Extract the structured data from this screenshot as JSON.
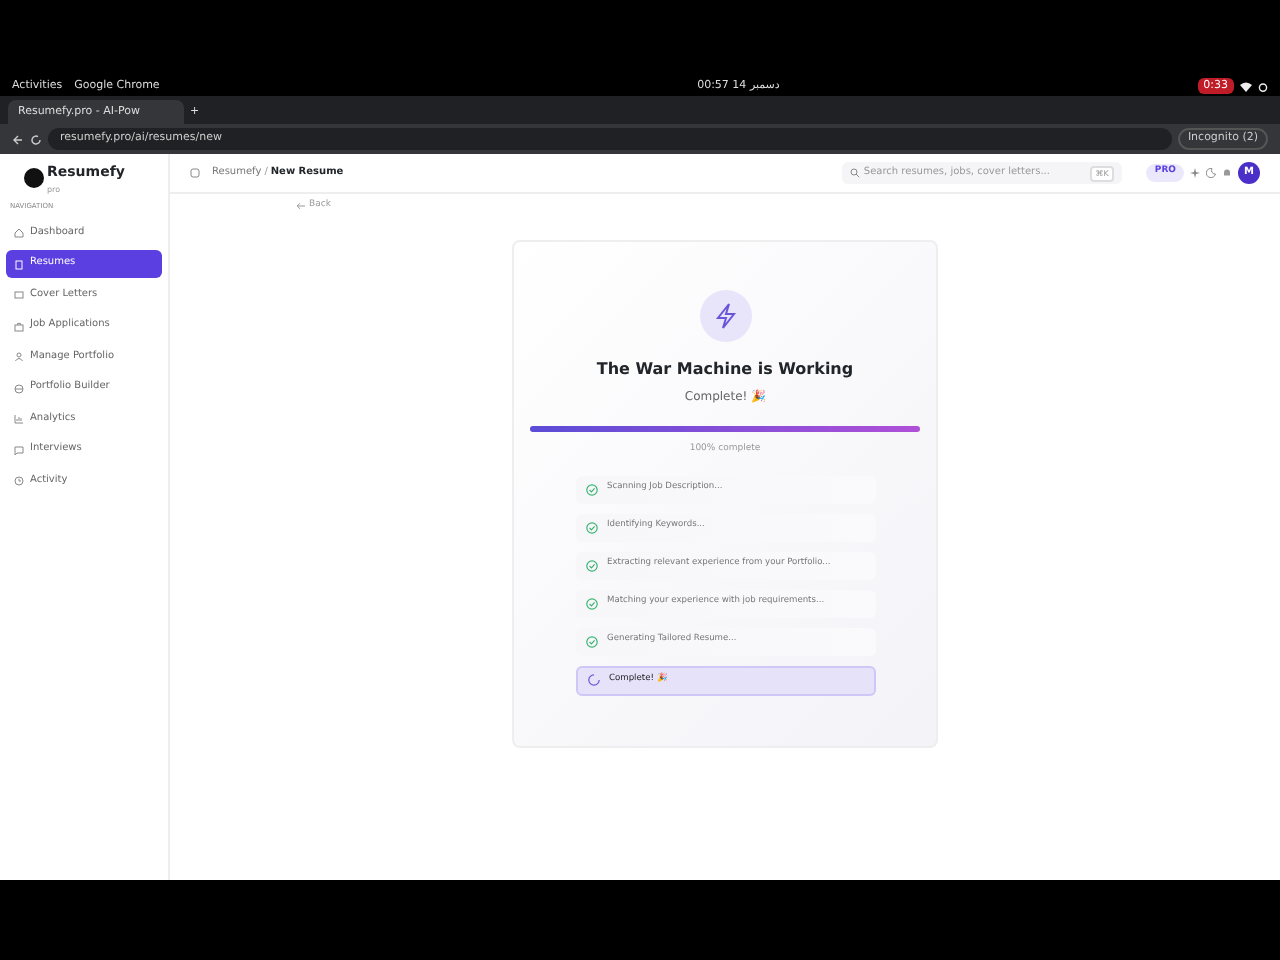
{
  "os_bar": {
    "activities": "Activities",
    "app": "Google Chrome",
    "clock": "00:57  14 دسمبر",
    "recording": "0:33"
  },
  "browser": {
    "tab_title": "Resumefy.pro - AI-Pow",
    "new_tab": "+",
    "url": "resumefy.pro/ai/resumes/new",
    "profile": "Incognito (2)"
  },
  "sidebar": {
    "brand": "Resumefy",
    "brand_sub": "pro",
    "section": "NAVIGATION",
    "items": [
      {
        "label": "Dashboard",
        "selected": false
      },
      {
        "label": "Resumes",
        "selected": true
      },
      {
        "label": "Cover Letters",
        "selected": false
      },
      {
        "label": "Job Applications",
        "selected": false
      },
      {
        "label": "Manage Portfolio",
        "selected": false
      },
      {
        "label": "Portfolio Builder",
        "selected": false
      },
      {
        "label": "Analytics",
        "selected": false
      },
      {
        "label": "Interviews",
        "selected": false
      },
      {
        "label": "Activity",
        "selected": false
      }
    ]
  },
  "header": {
    "breadcrumb": [
      "Resumefy",
      "New Resume"
    ],
    "breadcrumb_separator": "/",
    "search_placeholder": "Search resumes, jobs, cover letters...",
    "shortcut": "⌘K",
    "plan": "PRO",
    "avatar": "M"
  },
  "back": "Back",
  "card": {
    "title": "The War Machine is Working",
    "status": "Complete! 🎉",
    "progress": {
      "level": 1,
      "reading": "100% complete"
    },
    "steps": [
      {
        "label": "Scanning Job Description...",
        "kind": "done"
      },
      {
        "label": "Identifying Keywords...",
        "kind": "done"
      },
      {
        "label": "Extracting relevant experience from your Portfolio...",
        "kind": "done"
      },
      {
        "label": "Matching your experience with job requirements...",
        "kind": "done"
      },
      {
        "label": "Generating Tailored Resume...",
        "kind": "done"
      },
      {
        "label": "Complete! 🎉",
        "kind": "active"
      }
    ]
  }
}
